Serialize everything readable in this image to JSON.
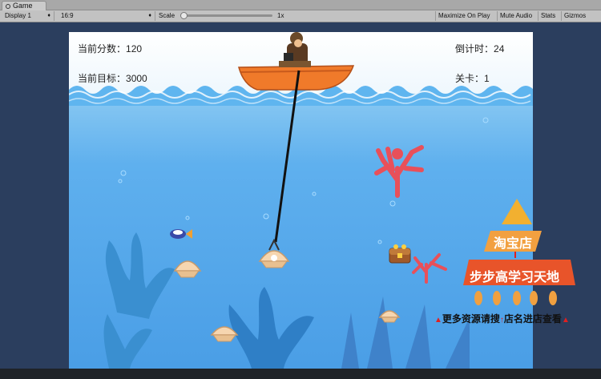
{
  "window": {
    "tab_title": "Game"
  },
  "toolbar": {
    "display": "Display 1",
    "aspect": "16:9",
    "scale_label": "Scale",
    "scale_value": "1x",
    "maximize": "Maximize On Play",
    "mute": "Mute Audio",
    "stats": "Stats",
    "gizmos": "Gizmos"
  },
  "hud": {
    "score_label": "当前分数：",
    "score_value": "120",
    "target_label": "当前目标：",
    "target_value": "3000",
    "countdown_label": "倒计时：",
    "countdown_value": "24",
    "level_label": "关卡：",
    "level_value": "1"
  },
  "shop": {
    "title": "淘宝店",
    "name": "步步高学习天地",
    "promo_left": "更多资源请搜",
    "promo_right": "店名进店查看"
  },
  "colors": {
    "sky": "#ffffff",
    "sea": "#4a9ee6",
    "boat": "#f07a2a",
    "coral_red": "#e8505a",
    "coral_blue": "#3a8fd0",
    "shop_orange": "#e86a2a"
  }
}
